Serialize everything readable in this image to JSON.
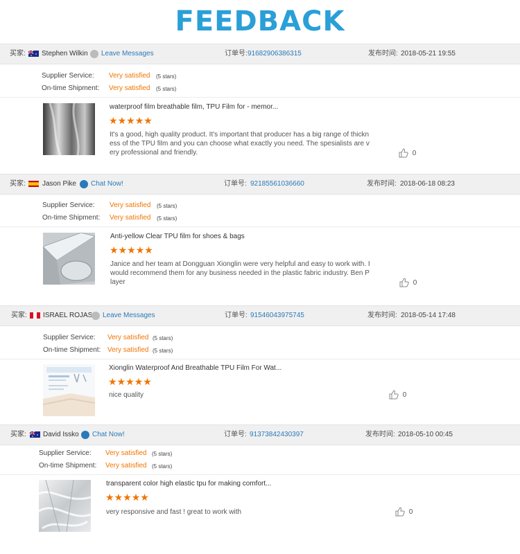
{
  "page_title": "FEEDBACK",
  "labels": {
    "buyer": "买家:",
    "order_no": "订单号:",
    "publish_time": "发布时间:",
    "supplier_service": "Supplier Service:",
    "ontime_shipment": "On-time Shipment:"
  },
  "reviews": [
    {
      "buyer_name": "Stephen Wilkin",
      "flag": "australia",
      "contact_label": "Leave Messages",
      "order_number": "91682906386315",
      "publish_time": "2018-05-21 19:55",
      "supplier_service": "Very satisfied",
      "supplier_service_stars": "(5 stars)",
      "ontime_shipment": "Very satisfied",
      "ontime_shipment_stars": "(5 stars)",
      "product_title": "waterproof film breathable film, TPU Film for - memor...",
      "rating": 5,
      "comment": "It's a good, high quality product. It's important that producer has a big range of thickness of the TPU film and you can choose what exactly you need. The spesialists are very professional and friendly.",
      "likes": "0"
    },
    {
      "buyer_name": "Jason Pike",
      "flag": "spain",
      "contact_label": "Chat Now!",
      "order_number": "92185561036660",
      "publish_time": "2018-06-18 08:23",
      "supplier_service": "Very satisfied",
      "supplier_service_stars": "(5 stars)",
      "ontime_shipment": "Very satisfied",
      "ontime_shipment_stars": "(5 stars)",
      "product_title": "Anti-yellow Clear TPU film for shoes & bags",
      "rating": 5,
      "comment": "Janice and her team at Dongguan Xionglin were very helpful and easy to work with. I would recommend them for any business needed in the plastic fabric industry. Ben Player",
      "likes": "0"
    },
    {
      "buyer_name": "ISRAEL ROJAS",
      "flag": "peru",
      "contact_label": "Leave Messages",
      "order_number": "91546043975745",
      "publish_time": "2018-05-14 17:48",
      "supplier_service": "Very satisfied",
      "supplier_service_stars": "(5 stars)",
      "ontime_shipment": "Very satisfied",
      "ontime_shipment_stars": "(5 stars)",
      "product_title": "Xionglin Waterproof And Breathable TPU Film For Wat...",
      "rating": 5,
      "comment": "nice quality",
      "likes": "0"
    },
    {
      "buyer_name": "David Issko",
      "flag": "australia",
      "contact_label": "Chat Now!",
      "order_number": "91373842430397",
      "publish_time": "2018-05-10 00:45",
      "supplier_service": "Very satisfied",
      "supplier_service_stars": "(5 stars)",
      "ontime_shipment": "Very satisfied",
      "ontime_shipment_stars": "(5 stars)",
      "product_title": "transparent color high elastic tpu for making comfort...",
      "rating": 5,
      "comment": "very responsive and fast ! great to work with",
      "likes": "0"
    }
  ]
}
